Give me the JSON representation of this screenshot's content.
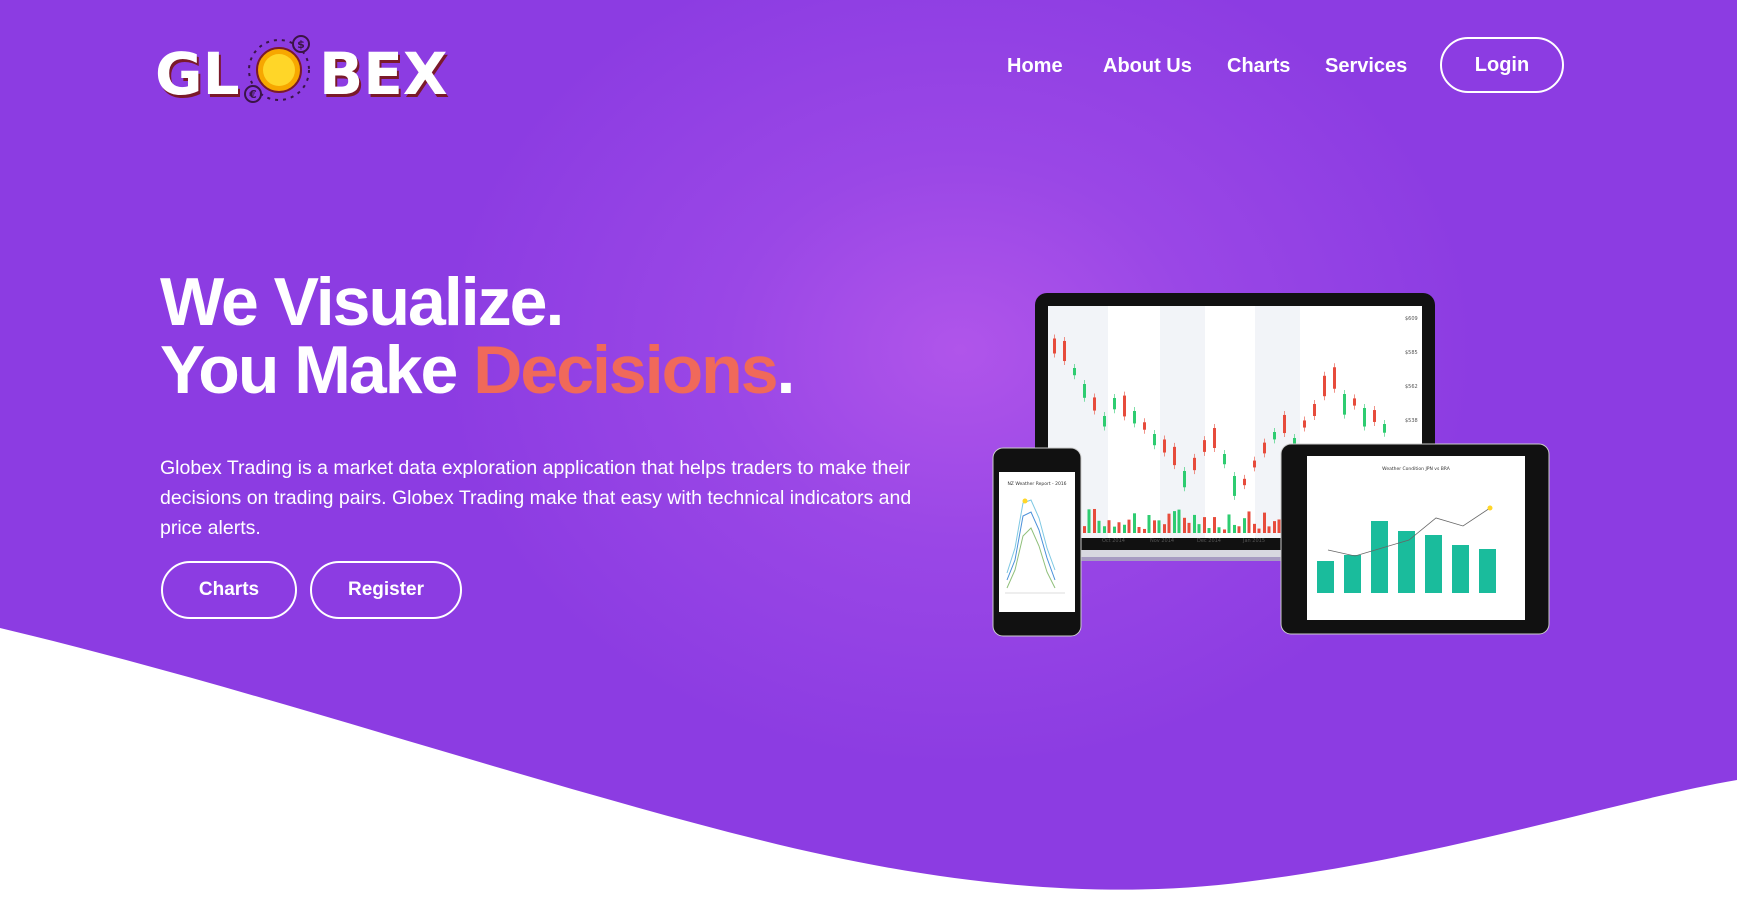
{
  "brand": {
    "name_left": "GL",
    "name_right": "BEX",
    "logo_icon": "globe-coin-icon"
  },
  "nav": {
    "items": [
      "Home",
      "About Us",
      "Charts",
      "Services"
    ],
    "login_label": "Login"
  },
  "hero": {
    "headline_line1": "We Visualize.",
    "headline_line2_prefix": "You Make ",
    "headline_line2_accent": "Decisions",
    "headline_line2_suffix": ".",
    "description": "Globex Trading is a market data exploration application that helps traders to make their decisions on trading pairs. Globex Trading make that easy with technical indicators and price alerts.",
    "buttons": {
      "charts": "Charts",
      "register": "Register"
    }
  },
  "mockups": {
    "laptop": {
      "price_labels": [
        "$609",
        "$585",
        "$562",
        "$538"
      ],
      "date_labels": [
        "Oct 2014",
        "Nov 2014",
        "Dec 2014",
        "Jan 2015"
      ]
    },
    "phone": {
      "title": "NZ Weather Report - 2016"
    },
    "tablet": {
      "title": "Weather Condition JPN vs BRA"
    }
  },
  "colors": {
    "background_purple": "#8c3ce2",
    "accent_coral": "#f0695a",
    "candle_up": "#2ecc71",
    "candle_down": "#e74c3c",
    "teal_bar": "#1abc9c"
  }
}
